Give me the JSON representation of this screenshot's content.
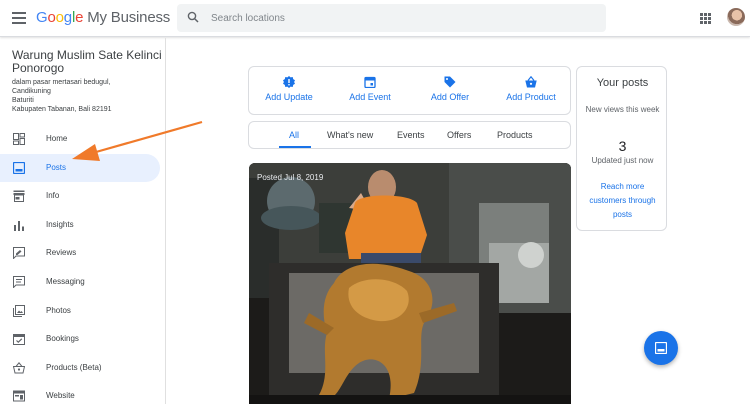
{
  "header": {
    "logo_google": [
      "G",
      "o",
      "o",
      "g",
      "l",
      "e"
    ],
    "logo_product": "My Business",
    "search_placeholder": "Search locations"
  },
  "business": {
    "name": "Warung Muslim Sate Kelinci Ponorogo",
    "address_lines": [
      "dalam pasar mertasari bedugul,",
      "Candikuning",
      "Baturiti",
      "Kabupaten Tabanan, Bali 82191"
    ]
  },
  "sidebar": {
    "active": "Posts",
    "items": [
      {
        "label": "Home",
        "icon": "dashboard-icon"
      },
      {
        "label": "Posts",
        "icon": "posts-icon"
      },
      {
        "label": "Info",
        "icon": "storefront-icon"
      },
      {
        "label": "Insights",
        "icon": "bar-chart-icon"
      },
      {
        "label": "Reviews",
        "icon": "reviews-icon"
      },
      {
        "label": "Messaging",
        "icon": "message-icon"
      },
      {
        "label": "Photos",
        "icon": "photos-icon"
      },
      {
        "label": "Bookings",
        "icon": "calendar-check-icon"
      },
      {
        "label": "Products (Beta)",
        "icon": "basket-icon"
      },
      {
        "label": "Website",
        "icon": "web-icon"
      }
    ]
  },
  "actions": [
    {
      "label": "Add Update",
      "icon": "update-icon"
    },
    {
      "label": "Add Event",
      "icon": "event-icon"
    },
    {
      "label": "Add Offer",
      "icon": "offer-tag-icon"
    },
    {
      "label": "Add Product",
      "icon": "product-basket-icon"
    }
  ],
  "tabs": {
    "active": "All",
    "items": [
      "All",
      "What's new",
      "Events",
      "Offers",
      "Products"
    ]
  },
  "post": {
    "posted_label": "Posted Jul 8, 2019"
  },
  "your_posts": {
    "title": "Your posts",
    "views_label": "New views this week",
    "count": "3",
    "updated": "Updated just now",
    "link": "Reach more customers through posts"
  },
  "colors": {
    "accent": "#1a73e8",
    "active_nav_bg": "#e8f0fe",
    "arrow": "#f07a2a"
  }
}
